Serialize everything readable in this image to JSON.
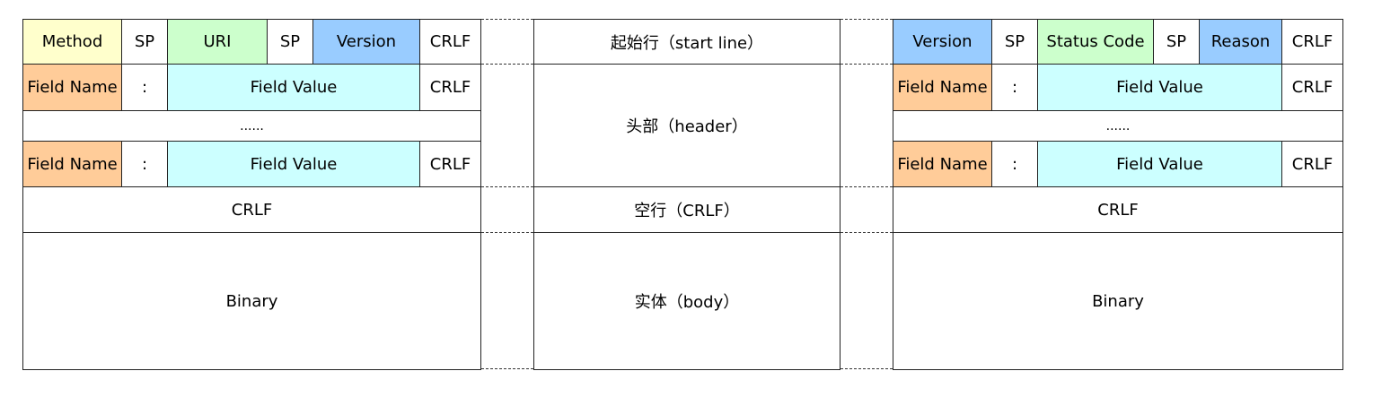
{
  "colors": {
    "method": "#FFFFCC",
    "uri_status": "#CCFFCC",
    "version_reason": "#99CCFF",
    "field_name": "#FFCC99",
    "field_value": "#CCFFFF"
  },
  "request": {
    "start_line": {
      "method": "Method",
      "sp1": "SP",
      "uri": "URI",
      "sp2": "SP",
      "version": "Version",
      "crlf": "CRLF"
    },
    "header_row_1": {
      "name": "Field Name",
      "colon": ":",
      "value": "Field Value",
      "crlf": "CRLF"
    },
    "ellipsis": "......",
    "header_row_2": {
      "name": "Field Name",
      "colon": ":",
      "value": "Field Value",
      "crlf": "CRLF"
    },
    "blank_line": "CRLF",
    "body": "Binary"
  },
  "middle": {
    "start_line": "起始行（start line）",
    "header": "头部（header）",
    "blank_line": "空行（CRLF）",
    "body": "实体（body）"
  },
  "response": {
    "start_line": {
      "version": "Version",
      "sp1": "SP",
      "status_code": "Status Code",
      "sp2": "SP",
      "reason": "Reason",
      "crlf": "CRLF"
    },
    "header_row_1": {
      "name": "Field Name",
      "colon": ":",
      "value": "Field Value",
      "crlf": "CRLF"
    },
    "ellipsis": "......",
    "header_row_2": {
      "name": "Field Name",
      "colon": ":",
      "value": "Field Value",
      "crlf": "CRLF"
    },
    "blank_line": "CRLF",
    "body": "Binary"
  }
}
